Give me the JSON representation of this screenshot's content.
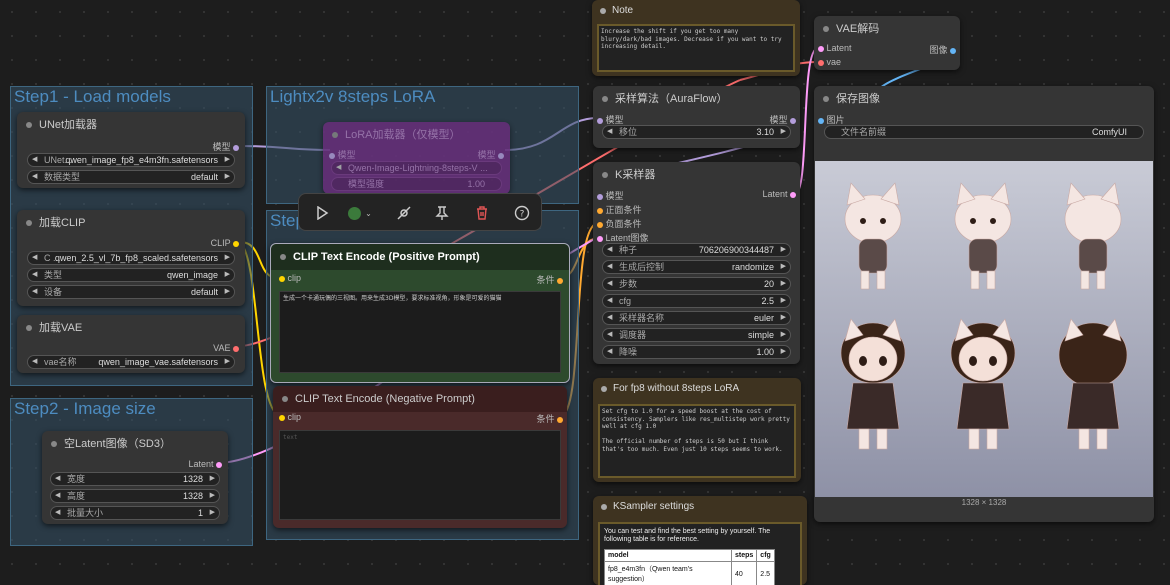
{
  "groups": {
    "step1": "Step1 - Load models",
    "lightx": "Lightx2v 8steps LoRA",
    "step3": "Step",
    "step2": "Step2 - Image size"
  },
  "unet": {
    "title": "UNet加载器",
    "out": "模型",
    "w1_label": "UNet...",
    "w1_value": "qwen_image_fp8_e4m3fn.safetensors",
    "w2_label": "数据类型",
    "w2_value": "default"
  },
  "clip_loader": {
    "title": "加载CLIP",
    "out": "CLIP",
    "w1_label": "C ...",
    "w1_value": "qwen_2.5_vl_7b_fp8_scaled.safetensors",
    "w2_label": "类型",
    "w2_value": "qwen_image",
    "w3_label": "设备",
    "w3_value": "default"
  },
  "vae_loader": {
    "title": "加载VAE",
    "out": "VAE",
    "w1_label": "vae名称",
    "w1_value": "qwen_image_vae.safetensors"
  },
  "latent": {
    "title": "空Latent图像（SD3）",
    "out": "Latent",
    "w1_label": "宽度",
    "w1_value": "1328",
    "w2_label": "高度",
    "w2_value": "1328",
    "w3_label": "批量大小",
    "w3_value": "1"
  },
  "lora": {
    "title": "LoRA加载器（仅模型）",
    "in": "模型",
    "out": "模型",
    "w1_value": "Qwen-Image-Lightning-8steps-V ...",
    "w2_label": "模型强度",
    "w2_value": "1.00"
  },
  "pos": {
    "title": "CLIP Text Encode (Positive Prompt)",
    "in": "clip",
    "out": "条件",
    "text": "生成一个卡通玩偶的三视图。用来生成3D模型，要求标准视角，形象是可爱的猫猫"
  },
  "neg": {
    "title": "CLIP Text Encode (Negative Prompt)",
    "in": "clip",
    "out": "条件",
    "text": "text"
  },
  "note": {
    "title": "Note",
    "text": "Increase the shift if you get too many blury/dark/bad images. Decrease if you want to try increasing detail."
  },
  "aura": {
    "title": "采样算法（AuraFlow）",
    "in": "模型",
    "out": "模型",
    "w1_label": "移位",
    "w1_value": "3.10"
  },
  "ksampler": {
    "title": "K采样器",
    "in_model": "模型",
    "in_pos": "正面条件",
    "in_neg": "负面条件",
    "in_latent": "Latent图像",
    "out": "Latent",
    "rows": [
      {
        "label": "种子",
        "value": "706206900344487"
      },
      {
        "label": "生成后控制",
        "value": "randomize"
      },
      {
        "label": "步数",
        "value": "20"
      },
      {
        "label": "cfg",
        "value": "2.5"
      },
      {
        "label": "采样器名称",
        "value": "euler"
      },
      {
        "label": "调度器",
        "value": "simple"
      },
      {
        "label": "降噪",
        "value": "1.00"
      }
    ]
  },
  "fp8note": {
    "title": "For fp8 without 8steps LoRA",
    "text": "Set cfg to 1.0 for a speed boost at the cost of consistency. Samplers like res_multistep work pretty well at cfg 1.0\n\nThe official number of steps is 50 but I think that's too much. Even just 10 steps seems to work."
  },
  "kset": {
    "title": "KSampler settings",
    "intro": "You can test and find the best setting by yourself. The following table is for reference.",
    "h1": "model",
    "h2": "steps",
    "h3": "cfg",
    "r1c1": "fp8_e4m3fn（Qwen team's suggestion）",
    "r1c2": "40",
    "r1c3": "2.5"
  },
  "vaedecode": {
    "title": "VAE解码",
    "in1": "Latent",
    "in2": "vae",
    "out": "图像"
  },
  "save": {
    "title": "保存图像",
    "in": "图片",
    "w1_label": "文件名前缀",
    "w1_value": "ComfyUI",
    "size": "1328 × 1328"
  },
  "colors": {
    "model": "#b39ddb",
    "clip": "#ffd500",
    "vae": "#ff6e6e",
    "latent": "#ff9cf9",
    "cond": "#ffa931",
    "image": "#64b5f6",
    "pos_node": "#2a4a2a",
    "neg_node": "#4a2a2a"
  }
}
